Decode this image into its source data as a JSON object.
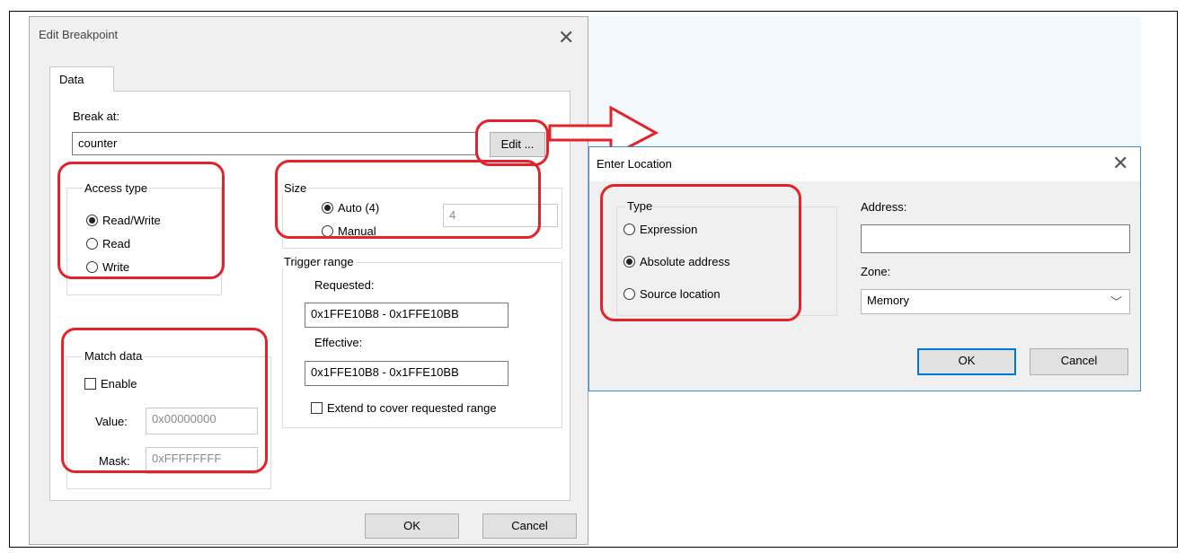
{
  "edit_breakpoint": {
    "title": "Edit Breakpoint",
    "tab": "Data",
    "break_at_label": "Break at:",
    "break_at_value": "counter",
    "edit_button": "Edit ...",
    "access_type": {
      "label": "Access type",
      "options": [
        "Read/Write",
        "Read",
        "Write"
      ],
      "selected": "Read/Write"
    },
    "size": {
      "label": "Size",
      "auto_label": "Auto (4)",
      "manual_label": "Manual",
      "selected": "Auto (4)",
      "value": "4"
    },
    "trigger_range": {
      "label": "Trigger range",
      "requested_label": "Requested:",
      "requested_value": "0x1FFE10B8 - 0x1FFE10BB",
      "effective_label": "Effective:",
      "effective_value": "0x1FFE10B8 - 0x1FFE10BB",
      "extend_label": "Extend to cover requested range",
      "extend_checked": false
    },
    "match_data": {
      "label": "Match data",
      "enable_label": "Enable",
      "enable_checked": false,
      "value_label": "Value:",
      "value": "0x00000000",
      "mask_label": "Mask:",
      "mask": "0xFFFFFFFF"
    },
    "ok_button": "OK",
    "cancel_button": "Cancel"
  },
  "enter_location": {
    "title": "Enter Location",
    "type": {
      "label": "Type",
      "options": [
        "Expression",
        "Absolute address",
        "Source location"
      ],
      "selected": "Absolute address"
    },
    "address_label": "Address:",
    "address_value": "",
    "zone_label": "Zone:",
    "zone_value": "Memory",
    "ok_button": "OK",
    "cancel_button": "Cancel"
  },
  "colors": {
    "highlight": "#e3232b",
    "dialog_bg": "#f0f0f0",
    "focus_blue": "#0078d7"
  }
}
